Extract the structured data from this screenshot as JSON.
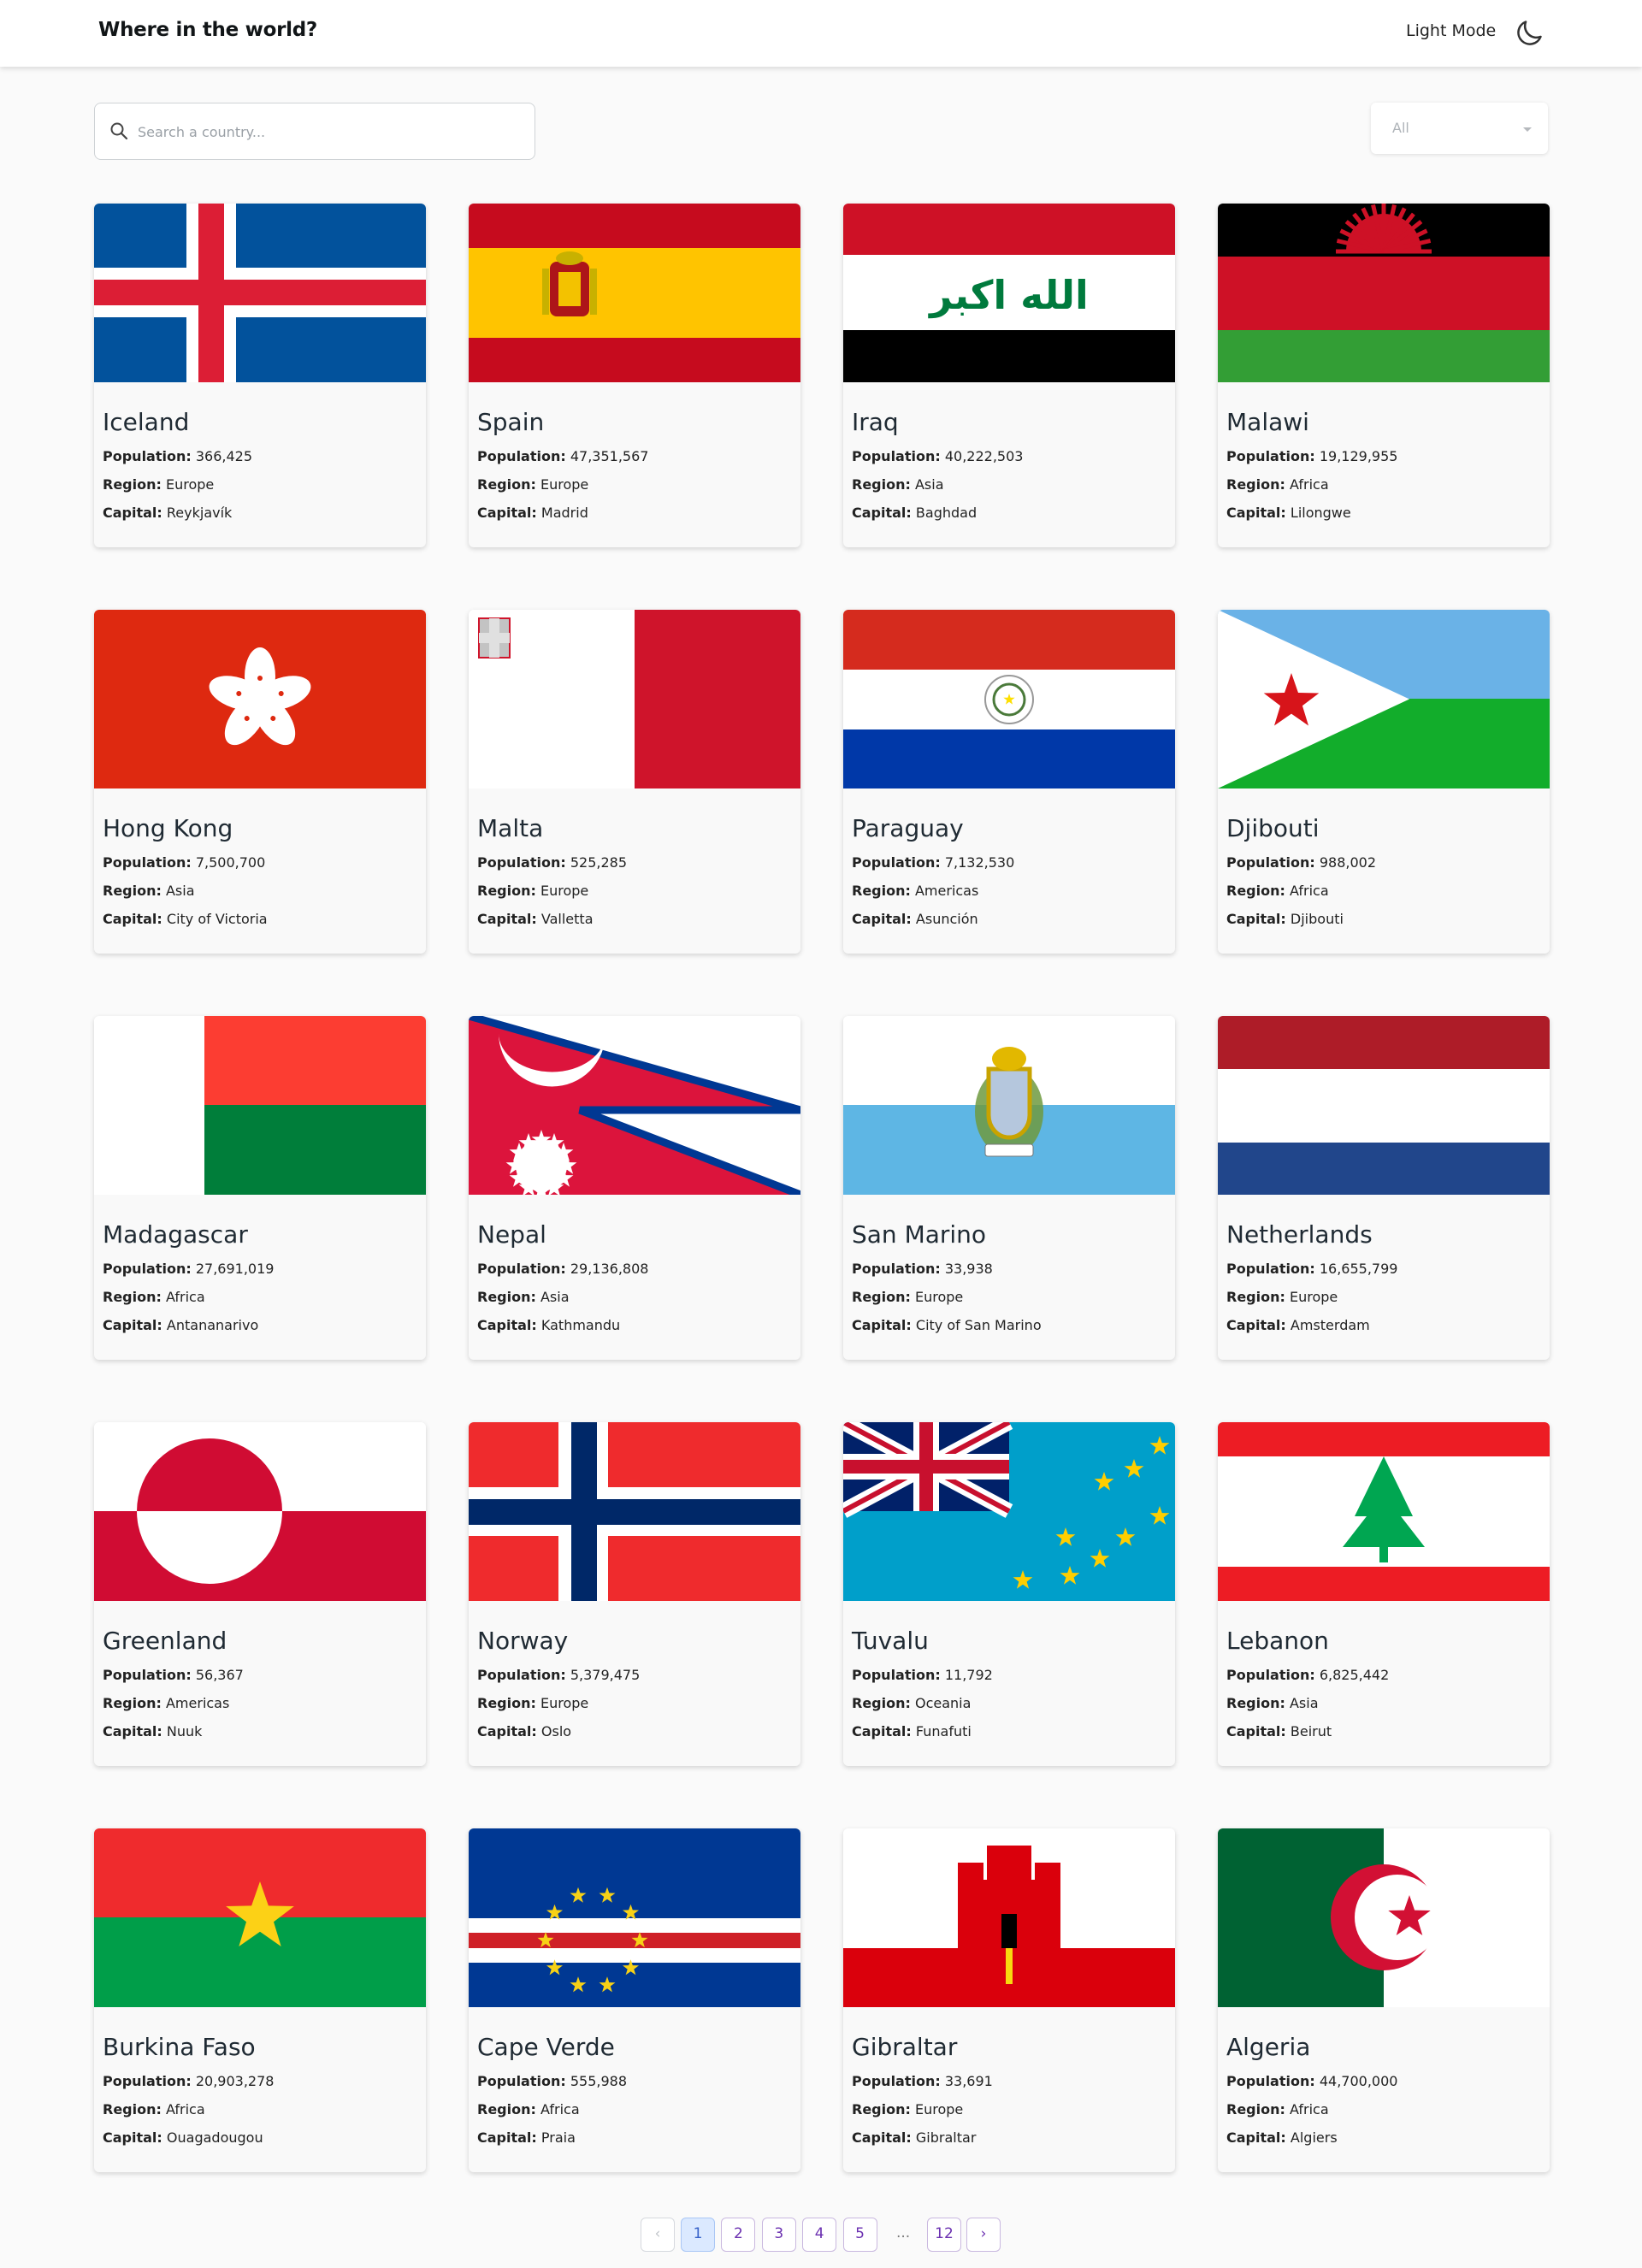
{
  "header": {
    "title": "Where in the world?",
    "mode_label": "Light Mode",
    "mode_icon": "moon-icon"
  },
  "search": {
    "placeholder": "Search a country...",
    "value": ""
  },
  "filter": {
    "selected": "All"
  },
  "labels": {
    "population": "Population:",
    "region": "Region:",
    "capital": "Capital:"
  },
  "countries": [
    {
      "name": "Iceland",
      "population": "366,425",
      "region": "Europe",
      "capital": "Reykjavík"
    },
    {
      "name": "Spain",
      "population": "47,351,567",
      "region": "Europe",
      "capital": "Madrid"
    },
    {
      "name": "Iraq",
      "population": "40,222,503",
      "region": "Asia",
      "capital": "Baghdad"
    },
    {
      "name": "Malawi",
      "population": "19,129,955",
      "region": "Africa",
      "capital": "Lilongwe"
    },
    {
      "name": "Hong Kong",
      "population": "7,500,700",
      "region": "Asia",
      "capital": "City of Victoria"
    },
    {
      "name": "Malta",
      "population": "525,285",
      "region": "Europe",
      "capital": "Valletta"
    },
    {
      "name": "Paraguay",
      "population": "7,132,530",
      "region": "Americas",
      "capital": "Asunción"
    },
    {
      "name": "Djibouti",
      "population": "988,002",
      "region": "Africa",
      "capital": "Djibouti"
    },
    {
      "name": "Madagascar",
      "population": "27,691,019",
      "region": "Africa",
      "capital": "Antananarivo"
    },
    {
      "name": "Nepal",
      "population": "29,136,808",
      "region": "Asia",
      "capital": "Kathmandu"
    },
    {
      "name": "San Marino",
      "population": "33,938",
      "region": "Europe",
      "capital": "City of San Marino"
    },
    {
      "name": "Netherlands",
      "population": "16,655,799",
      "region": "Europe",
      "capital": "Amsterdam"
    },
    {
      "name": "Greenland",
      "population": "56,367",
      "region": "Americas",
      "capital": "Nuuk"
    },
    {
      "name": "Norway",
      "population": "5,379,475",
      "region": "Europe",
      "capital": "Oslo"
    },
    {
      "name": "Tuvalu",
      "population": "11,792",
      "region": "Oceania",
      "capital": "Funafuti"
    },
    {
      "name": "Lebanon",
      "population": "6,825,442",
      "region": "Asia",
      "capital": "Beirut"
    },
    {
      "name": "Burkina Faso",
      "population": "20,903,278",
      "region": "Africa",
      "capital": "Ouagadougou"
    },
    {
      "name": "Cape Verde",
      "population": "555,988",
      "region": "Africa",
      "capital": "Praia"
    },
    {
      "name": "Gibraltar",
      "population": "33,691",
      "region": "Europe",
      "capital": "Gibraltar"
    },
    {
      "name": "Algeria",
      "population": "44,700,000",
      "region": "Africa",
      "capital": "Algiers"
    }
  ],
  "pagination": {
    "prev": "‹",
    "pages": [
      "1",
      "2",
      "3",
      "4",
      "5"
    ],
    "ellipsis": "...",
    "last": "12",
    "next": "›",
    "current": "1"
  },
  "colors": {
    "accent": "#6a2fb0",
    "active_page_bg": "#dbe9ff"
  }
}
